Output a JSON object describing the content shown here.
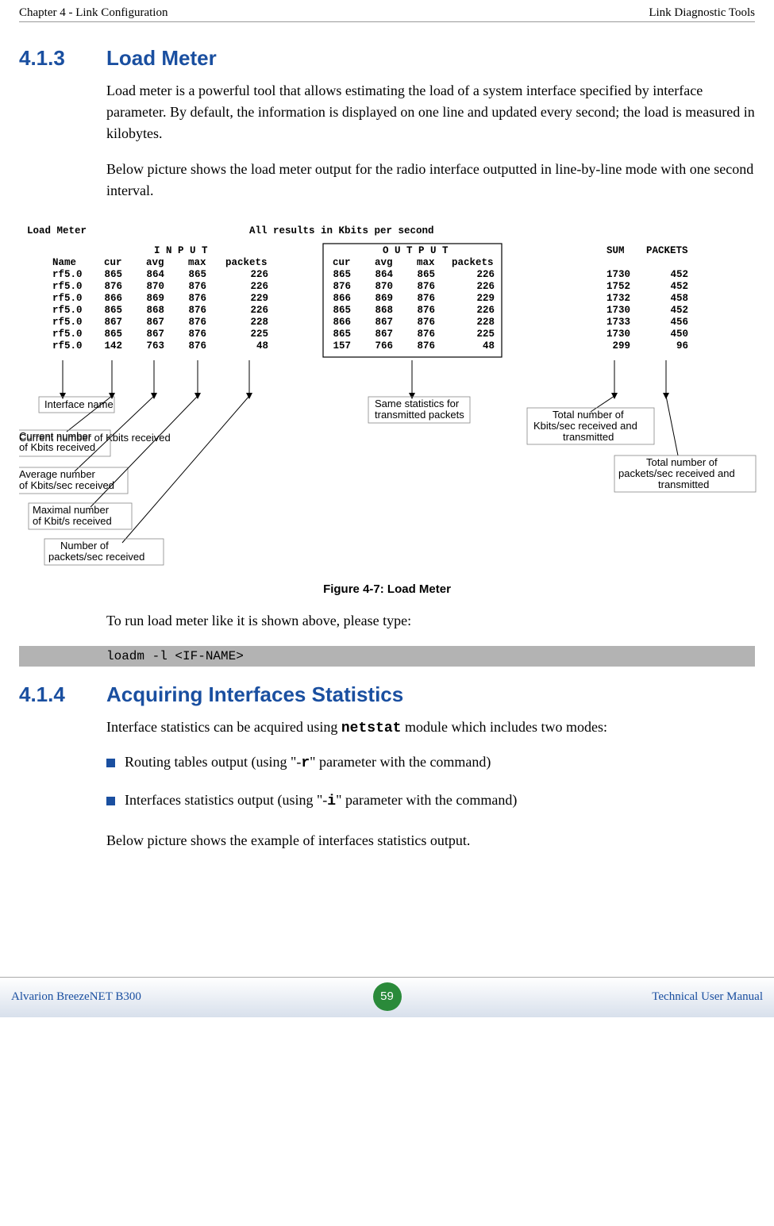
{
  "header": {
    "left": "Chapter 4 - Link Configuration",
    "right": "Link Diagnostic Tools"
  },
  "section_413": {
    "number": "4.1.3",
    "title": "Load Meter",
    "para1": "Load meter is a powerful tool that allows estimating the load of a system interface specified by interface parameter. By default, the information is displayed on one line and updated every second; the load is measured in kilobytes.",
    "para2": "Below picture shows the load meter output for the radio interface outputted in line-by-line mode with one second interval.",
    "figure": {
      "caption": "Figure 4-7: Load Meter",
      "title": "Load Meter",
      "subtitle": "All results in Kbits per second",
      "column_headers": {
        "input_group": "I N P U T",
        "output_group": "O U T P U T",
        "name": "Name",
        "cur": "cur",
        "avg": "avg",
        "max": "max",
        "packets": "packets",
        "sum": "SUM",
        "packets2": "PACKETS"
      },
      "annotations": {
        "iface_name": "Interface name",
        "cur_kbits": "Current number of Kbits received",
        "avg_kbits": "Average number of Kbits/sec received",
        "max_kbits": "Maximal number of Kbit/s received",
        "packets_rx": "Number of packets/sec received",
        "same_stats": "Same statistics for transmitted packets",
        "total_kbits": "Total number of Kbits/sec received and transmitted",
        "total_packets": "Total number of packets/sec received and transmitted"
      }
    },
    "after_figure": "To run load meter like it is shown above, please type:",
    "code": "loadm -l <IF-NAME>"
  },
  "section_414": {
    "number": "4.1.4",
    "title": "Acquiring Interfaces Statistics",
    "para1a": "Interface statistics can be acquired using ",
    "para1_cmd": "netstat",
    "para1b": " module which includes two modes:",
    "bullet1a": "Routing tables output (using \"-",
    "bullet1_param": "r",
    "bullet1b": "\" parameter with the command)",
    "bullet2a": "Interfaces statistics output (using \"-",
    "bullet2_param": "i",
    "bullet2b": "\" parameter with the command)",
    "para2": "Below picture shows the example of interfaces statistics output."
  },
  "footer": {
    "left": "Alvarion BreezeNET B300",
    "page": "59",
    "right": "Technical User Manual"
  },
  "chart_data": {
    "type": "table",
    "title": "Load Meter — All results in Kbits per second",
    "columns": [
      "Name",
      "in_cur",
      "in_avg",
      "in_max",
      "in_packets",
      "out_cur",
      "out_avg",
      "out_max",
      "out_packets",
      "SUM",
      "PACKETS"
    ],
    "rows": [
      {
        "Name": "rf5.0",
        "in_cur": 865,
        "in_avg": 864,
        "in_max": 865,
        "in_packets": 226,
        "out_cur": 865,
        "out_avg": 864,
        "out_max": 865,
        "out_packets": 226,
        "SUM": 1730,
        "PACKETS": 452
      },
      {
        "Name": "rf5.0",
        "in_cur": 876,
        "in_avg": 870,
        "in_max": 876,
        "in_packets": 226,
        "out_cur": 876,
        "out_avg": 870,
        "out_max": 876,
        "out_packets": 226,
        "SUM": 1752,
        "PACKETS": 452
      },
      {
        "Name": "rf5.0",
        "in_cur": 866,
        "in_avg": 869,
        "in_max": 876,
        "in_packets": 229,
        "out_cur": 866,
        "out_avg": 869,
        "out_max": 876,
        "out_packets": 229,
        "SUM": 1732,
        "PACKETS": 458
      },
      {
        "Name": "rf5.0",
        "in_cur": 865,
        "in_avg": 868,
        "in_max": 876,
        "in_packets": 226,
        "out_cur": 865,
        "out_avg": 868,
        "out_max": 876,
        "out_packets": 226,
        "SUM": 1730,
        "PACKETS": 452
      },
      {
        "Name": "rf5.0",
        "in_cur": 867,
        "in_avg": 867,
        "in_max": 876,
        "in_packets": 228,
        "out_cur": 866,
        "out_avg": 867,
        "out_max": 876,
        "out_packets": 228,
        "SUM": 1733,
        "PACKETS": 456
      },
      {
        "Name": "rf5.0",
        "in_cur": 865,
        "in_avg": 867,
        "in_max": 876,
        "in_packets": 225,
        "out_cur": 865,
        "out_avg": 867,
        "out_max": 876,
        "out_packets": 225,
        "SUM": 1730,
        "PACKETS": 450
      },
      {
        "Name": "rf5.0",
        "in_cur": 142,
        "in_avg": 763,
        "in_max": 876,
        "in_packets": 48,
        "out_cur": 157,
        "out_avg": 766,
        "out_max": 876,
        "out_packets": 48,
        "SUM": 299,
        "PACKETS": 96
      }
    ]
  }
}
